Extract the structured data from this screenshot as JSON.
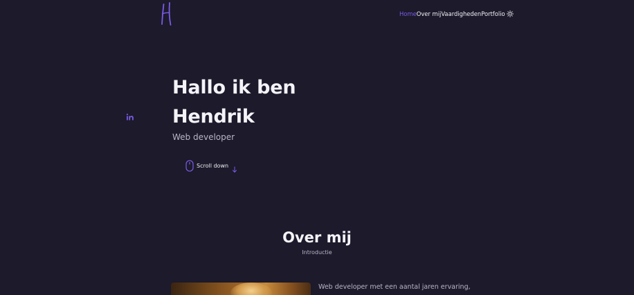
{
  "header": {
    "logo_icon": "handwritten-h-logo",
    "nav": {
      "home": "Home",
      "about": "Over mij",
      "skills": "Vaardigheden",
      "portfolio": "Portfolio"
    },
    "theme_icon": "sun-icon"
  },
  "social": {
    "icon": "linkedin-icon"
  },
  "hero": {
    "title_line1": "Hallo ik ben",
    "title_line2": "Hendrik",
    "subtitle": "Web developer",
    "scroll_label": "Scroll down"
  },
  "about": {
    "title": "Over mij",
    "subtitle": "Introductie",
    "text": "Web developer met een aantal jaren ervaring,"
  },
  "colors": {
    "background": "#1c1a2b",
    "accent": "#7b5ce6",
    "text": "#f2f1f6",
    "muted": "#b9b6c8"
  }
}
